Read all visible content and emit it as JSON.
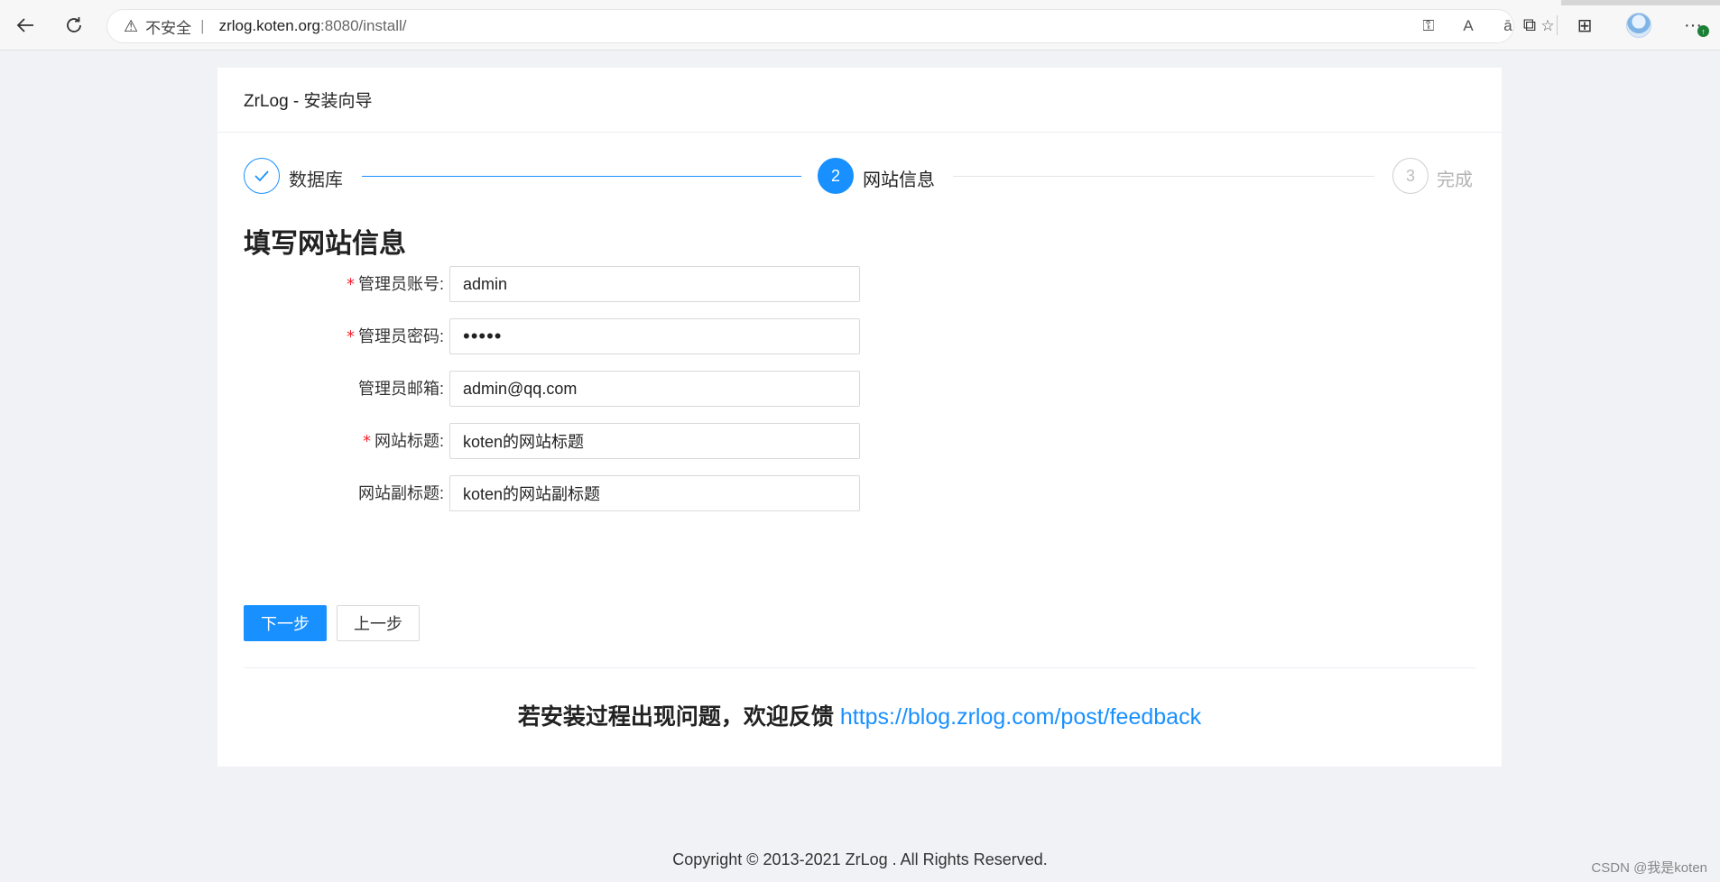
{
  "browser": {
    "insecure_label": "不安全",
    "url_host": "zrlog.koten.org",
    "url_path": ":8080/install/"
  },
  "card": {
    "title": "ZrLog - 安装向导"
  },
  "steps": [
    {
      "number": "1",
      "label": "数据库",
      "status": "done"
    },
    {
      "number": "2",
      "label": "网站信息",
      "status": "active"
    },
    {
      "number": "3",
      "label": "完成",
      "status": "wait"
    }
  ],
  "form": {
    "title": "填写网站信息",
    "fields": [
      {
        "label": "管理员账号:",
        "required": true,
        "value": "admin"
      },
      {
        "label": "管理员密码:",
        "required": true,
        "value": "•••••"
      },
      {
        "label": "管理员邮箱:",
        "required": false,
        "value": "admin@qq.com"
      },
      {
        "label": "网站标题:",
        "required": true,
        "value": "koten的网站标题"
      },
      {
        "label": "网站副标题:",
        "required": false,
        "value": "koten的网站副标题"
      }
    ],
    "required_mark": "*"
  },
  "buttons": {
    "next": "下一步",
    "prev": "上一步"
  },
  "feedback": {
    "text": "若安装过程出现问题，欢迎反馈 ",
    "link": "https://blog.zrlog.com/post/feedback"
  },
  "footer": {
    "copyright": "Copyright © 2013-2021 ZrLog . All Rights Reserved."
  },
  "watermark": "CSDN @我是koten",
  "colors": {
    "primary": "#1890ff",
    "required": "#f5222d",
    "background": "#f0f2f5"
  }
}
